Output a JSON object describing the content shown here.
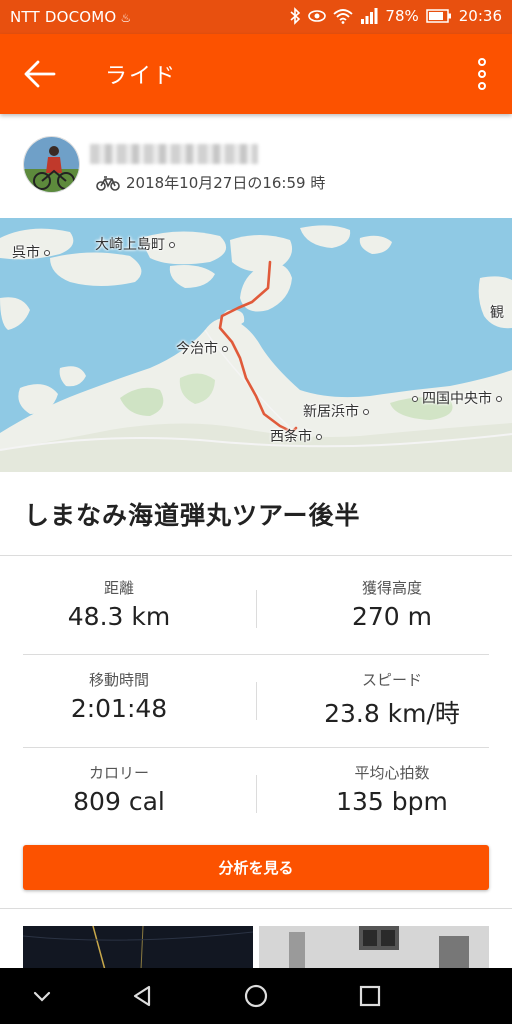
{
  "status_bar": {
    "carrier": "NTT DOCOMO",
    "battery": "78%",
    "time": "20:36"
  },
  "app_bar": {
    "title": "ライド"
  },
  "activity": {
    "date_time": "2018年10月27日の16:59 時",
    "title": "しまなみ海道弾丸ツアー後半"
  },
  "map": {
    "labels": [
      "呉市",
      "大崎上島町",
      "観",
      "今治市",
      "新居浜市",
      "四国中央市",
      "西条市"
    ]
  },
  "stats": [
    {
      "label": "距離",
      "value": "48.3 km"
    },
    {
      "label": "獲得高度",
      "value": "270 m"
    },
    {
      "label": "移動時間",
      "value": "2:01:48"
    },
    {
      "label": "スピード",
      "value": "23.8 km/時"
    },
    {
      "label": "カロリー",
      "value": "809 cal"
    },
    {
      "label": "平均心拍数",
      "value": "135 bpm"
    }
  ],
  "actions": {
    "analyze_label": "分析を見る"
  },
  "colors": {
    "accent": "#fc5200",
    "status_bar": "#e8500f",
    "route": "#e05a3a",
    "sea": "#8fc9e4",
    "land": "#eef0ea"
  }
}
